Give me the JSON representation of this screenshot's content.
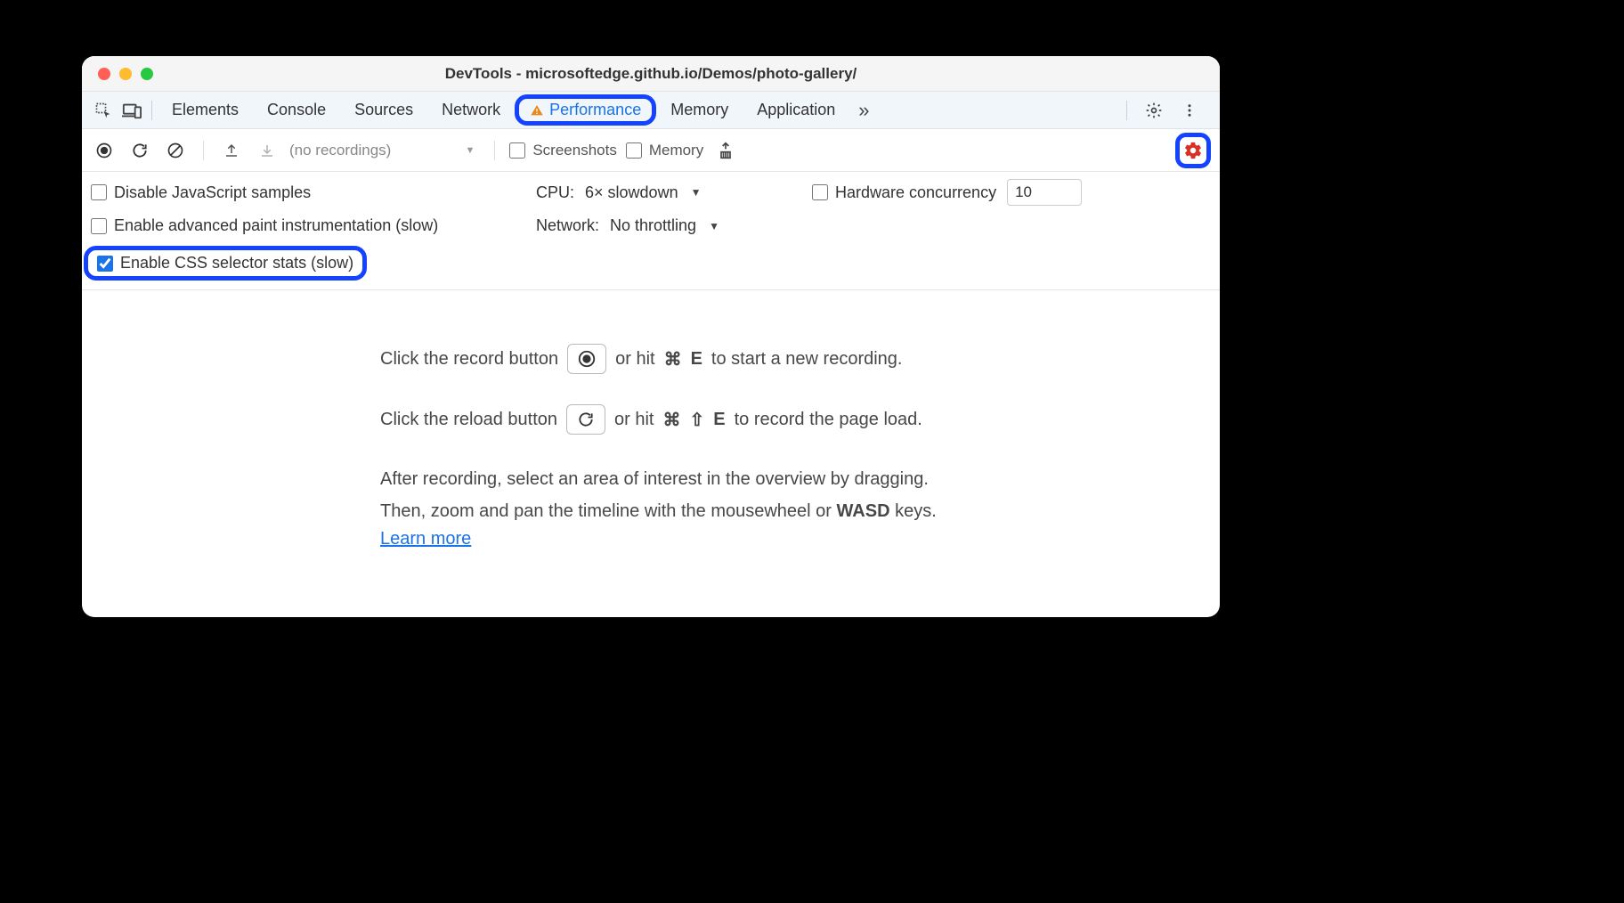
{
  "window_title": "DevTools - microsoftedge.github.io/Demos/photo-gallery/",
  "tabs": {
    "elements": "Elements",
    "console": "Console",
    "sources": "Sources",
    "network": "Network",
    "performance": "Performance",
    "memory": "Memory",
    "application": "Application"
  },
  "toolbar": {
    "recordings_placeholder": "(no recordings)",
    "screenshots_label": "Screenshots",
    "memory_label": "Memory"
  },
  "settings": {
    "disable_js_samples": "Disable JavaScript samples",
    "cpu_label": "CPU:",
    "cpu_value": "6× slowdown",
    "hardware_concurrency_label": "Hardware concurrency",
    "hardware_concurrency_value": "10",
    "advanced_paint": "Enable advanced paint instrumentation (slow)",
    "network_label": "Network:",
    "network_value": "No throttling",
    "css_selector_stats": "Enable CSS selector stats (slow)"
  },
  "empty_state": {
    "record_pre": "Click the record button",
    "record_post_pre": "or hit",
    "record_key1": "⌘",
    "record_key2": "E",
    "record_post": "to start a new recording.",
    "reload_pre": "Click the reload button",
    "reload_post_pre": "or hit",
    "reload_key1": "⌘",
    "reload_key2": "⇧",
    "reload_key3": "E",
    "reload_post": "to record the page load.",
    "para1": "After recording, select an area of interest in the overview by dragging.",
    "para2_pre": "Then, zoom and pan the timeline with the mousewheel or ",
    "para2_key": "WASD",
    "para2_post": " keys.",
    "learn_more": "Learn more"
  }
}
